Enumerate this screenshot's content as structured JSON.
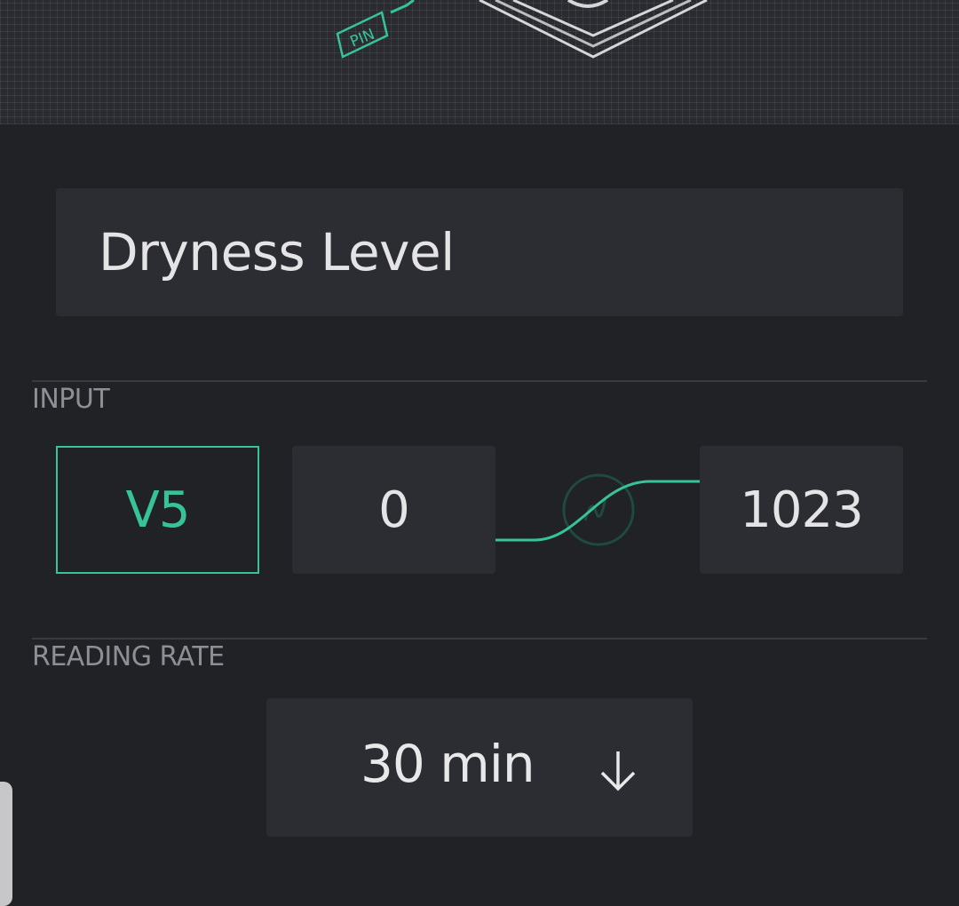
{
  "header": {
    "pin_badge": "PIN"
  },
  "widget": {
    "name": "Dryness Level"
  },
  "input_section": {
    "label": "INPUT",
    "pin": "V5",
    "min_value": "0",
    "max_value": "1023",
    "icons": {
      "mapping": "wave-icon"
    }
  },
  "reading_rate_section": {
    "label": "READING RATE",
    "selected": "30 min",
    "icons": {
      "dropdown": "arrow-down-icon"
    }
  },
  "colors": {
    "accent": "#37c398",
    "background": "#212226",
    "field": "#2c2d32"
  }
}
